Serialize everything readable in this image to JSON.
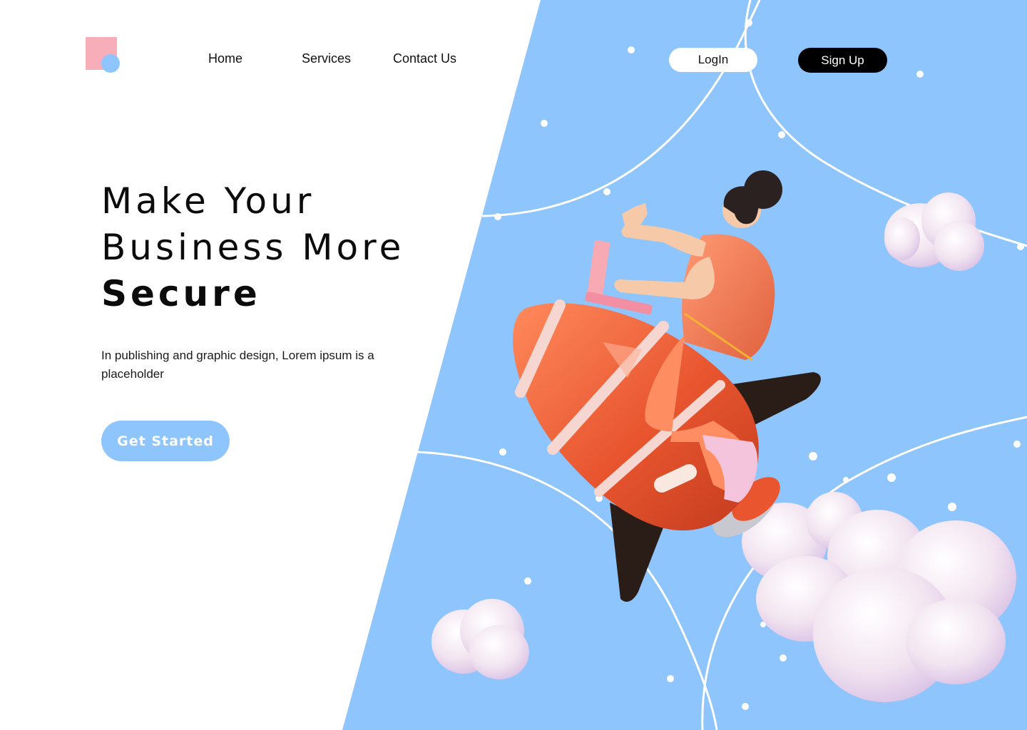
{
  "brand": {
    "logo_icon": "logo-mark",
    "colors": {
      "logo_square": "#F7AEB8",
      "logo_circle": "#8EC5FC",
      "accent_blue": "#8EC5FC",
      "rocket": "#E8552F",
      "cloud": "#F4E6F4",
      "dark": "#000000"
    }
  },
  "nav": {
    "items": [
      {
        "label": "Home"
      },
      {
        "label": "Services"
      },
      {
        "label": "Contact Us"
      }
    ],
    "login_label": "LogIn",
    "signup_label": "Sign Up"
  },
  "hero": {
    "headline_line1": "Make Your",
    "headline_line2": "Business More",
    "headline_line3": "Secure",
    "description": "In publishing and graphic design, Lorem ipsum is a placeholder",
    "cta_label": "Get Started",
    "illustration": "person-riding-rocket-illustration"
  }
}
